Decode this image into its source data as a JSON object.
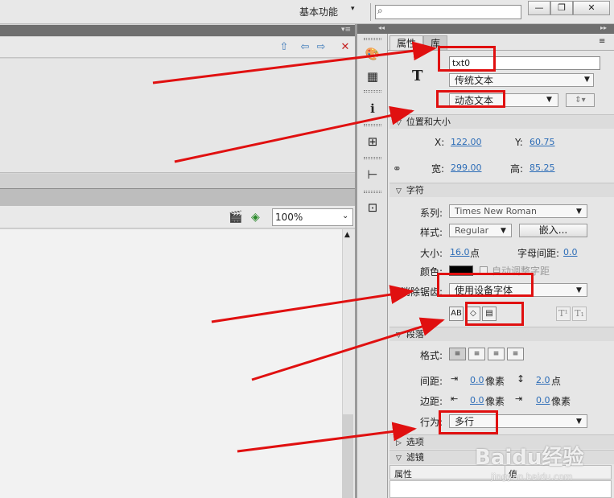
{
  "topbar": {
    "workspace_label": "基本功能",
    "workspace_caret": "▾",
    "search_icon": "⌕",
    "window_buttons": {
      "minimize": "—",
      "maximize": "❐",
      "close": "✕"
    }
  },
  "left_panel": {
    "nav_icons": {
      "up": "⇧",
      "back": "⇦",
      "forward": "⇨",
      "delete": "✕"
    },
    "toolbar2": {
      "clapper_icon": "🎬",
      "shape_icon": "◈"
    },
    "zoom": {
      "value": "100%",
      "caret": "⌄"
    },
    "scroll_up": "▲"
  },
  "tool_strip_icons": [
    "🎨",
    "▦",
    "ℹ",
    "⊞",
    "⊢",
    "⊡"
  ],
  "properties": {
    "tabs": [
      "属性",
      "库"
    ],
    "menu_icon": "≡",
    "text_tool_icon": "T",
    "instance_name": "txt0",
    "text_engine": "传统文本",
    "text_type": "动态文本",
    "orientation_icon": "⇕▾",
    "position_size": {
      "section_title": "位置和大小",
      "x_label": "X:",
      "x_value": "122.00",
      "y_label": "Y:",
      "y_value": "60.75",
      "w_label": "宽:",
      "w_value": "299.00",
      "h_label": "高:",
      "h_value": "85.25",
      "link_icon": "⚭"
    },
    "character": {
      "section_title": "字符",
      "family_label": "系列:",
      "family_value": "Times New Roman",
      "style_label": "样式:",
      "style_value": "Regular",
      "embed_label": "嵌入...",
      "size_label": "大小:",
      "size_value": "16.0",
      "size_unit": "点",
      "spacing_label": "字母间距:",
      "spacing_value": "0.0",
      "color_label": "颜色:",
      "autokern_label": "自动调整字距",
      "aa_label": "消除锯齿:",
      "aa_value": "使用设备字体",
      "format_buttons": [
        "AB",
        "◇",
        "▤"
      ],
      "sup_buttons": [
        "T¹",
        "T₁"
      ]
    },
    "paragraph": {
      "section_title": "段落",
      "format_label": "格式:",
      "align_buttons": [
        "≡",
        "≡",
        "≡",
        "≡"
      ],
      "spacing_label": "间距:",
      "indent_icon": "⇥",
      "indent_value": "0.0",
      "indent_unit": "像素",
      "line_icon": "↕",
      "line_value": "2.0",
      "line_unit": "点",
      "margin_label": "边距:",
      "left_margin_icon": "⇤",
      "left_margin_value": "0.0",
      "left_margin_unit": "像素",
      "right_margin_icon": "⇥",
      "right_margin_value": "0.0",
      "right_margin_unit": "像素",
      "behavior_label": "行为:",
      "behavior_value": "多行"
    },
    "options_section_title": "选项",
    "filters": {
      "section_title": "滤镜",
      "col_property": "属性",
      "col_value": "值"
    }
  },
  "watermark": {
    "text": "Baidu经验",
    "url": "jingyan.baidu.com"
  },
  "annotation_color": "#e01010"
}
